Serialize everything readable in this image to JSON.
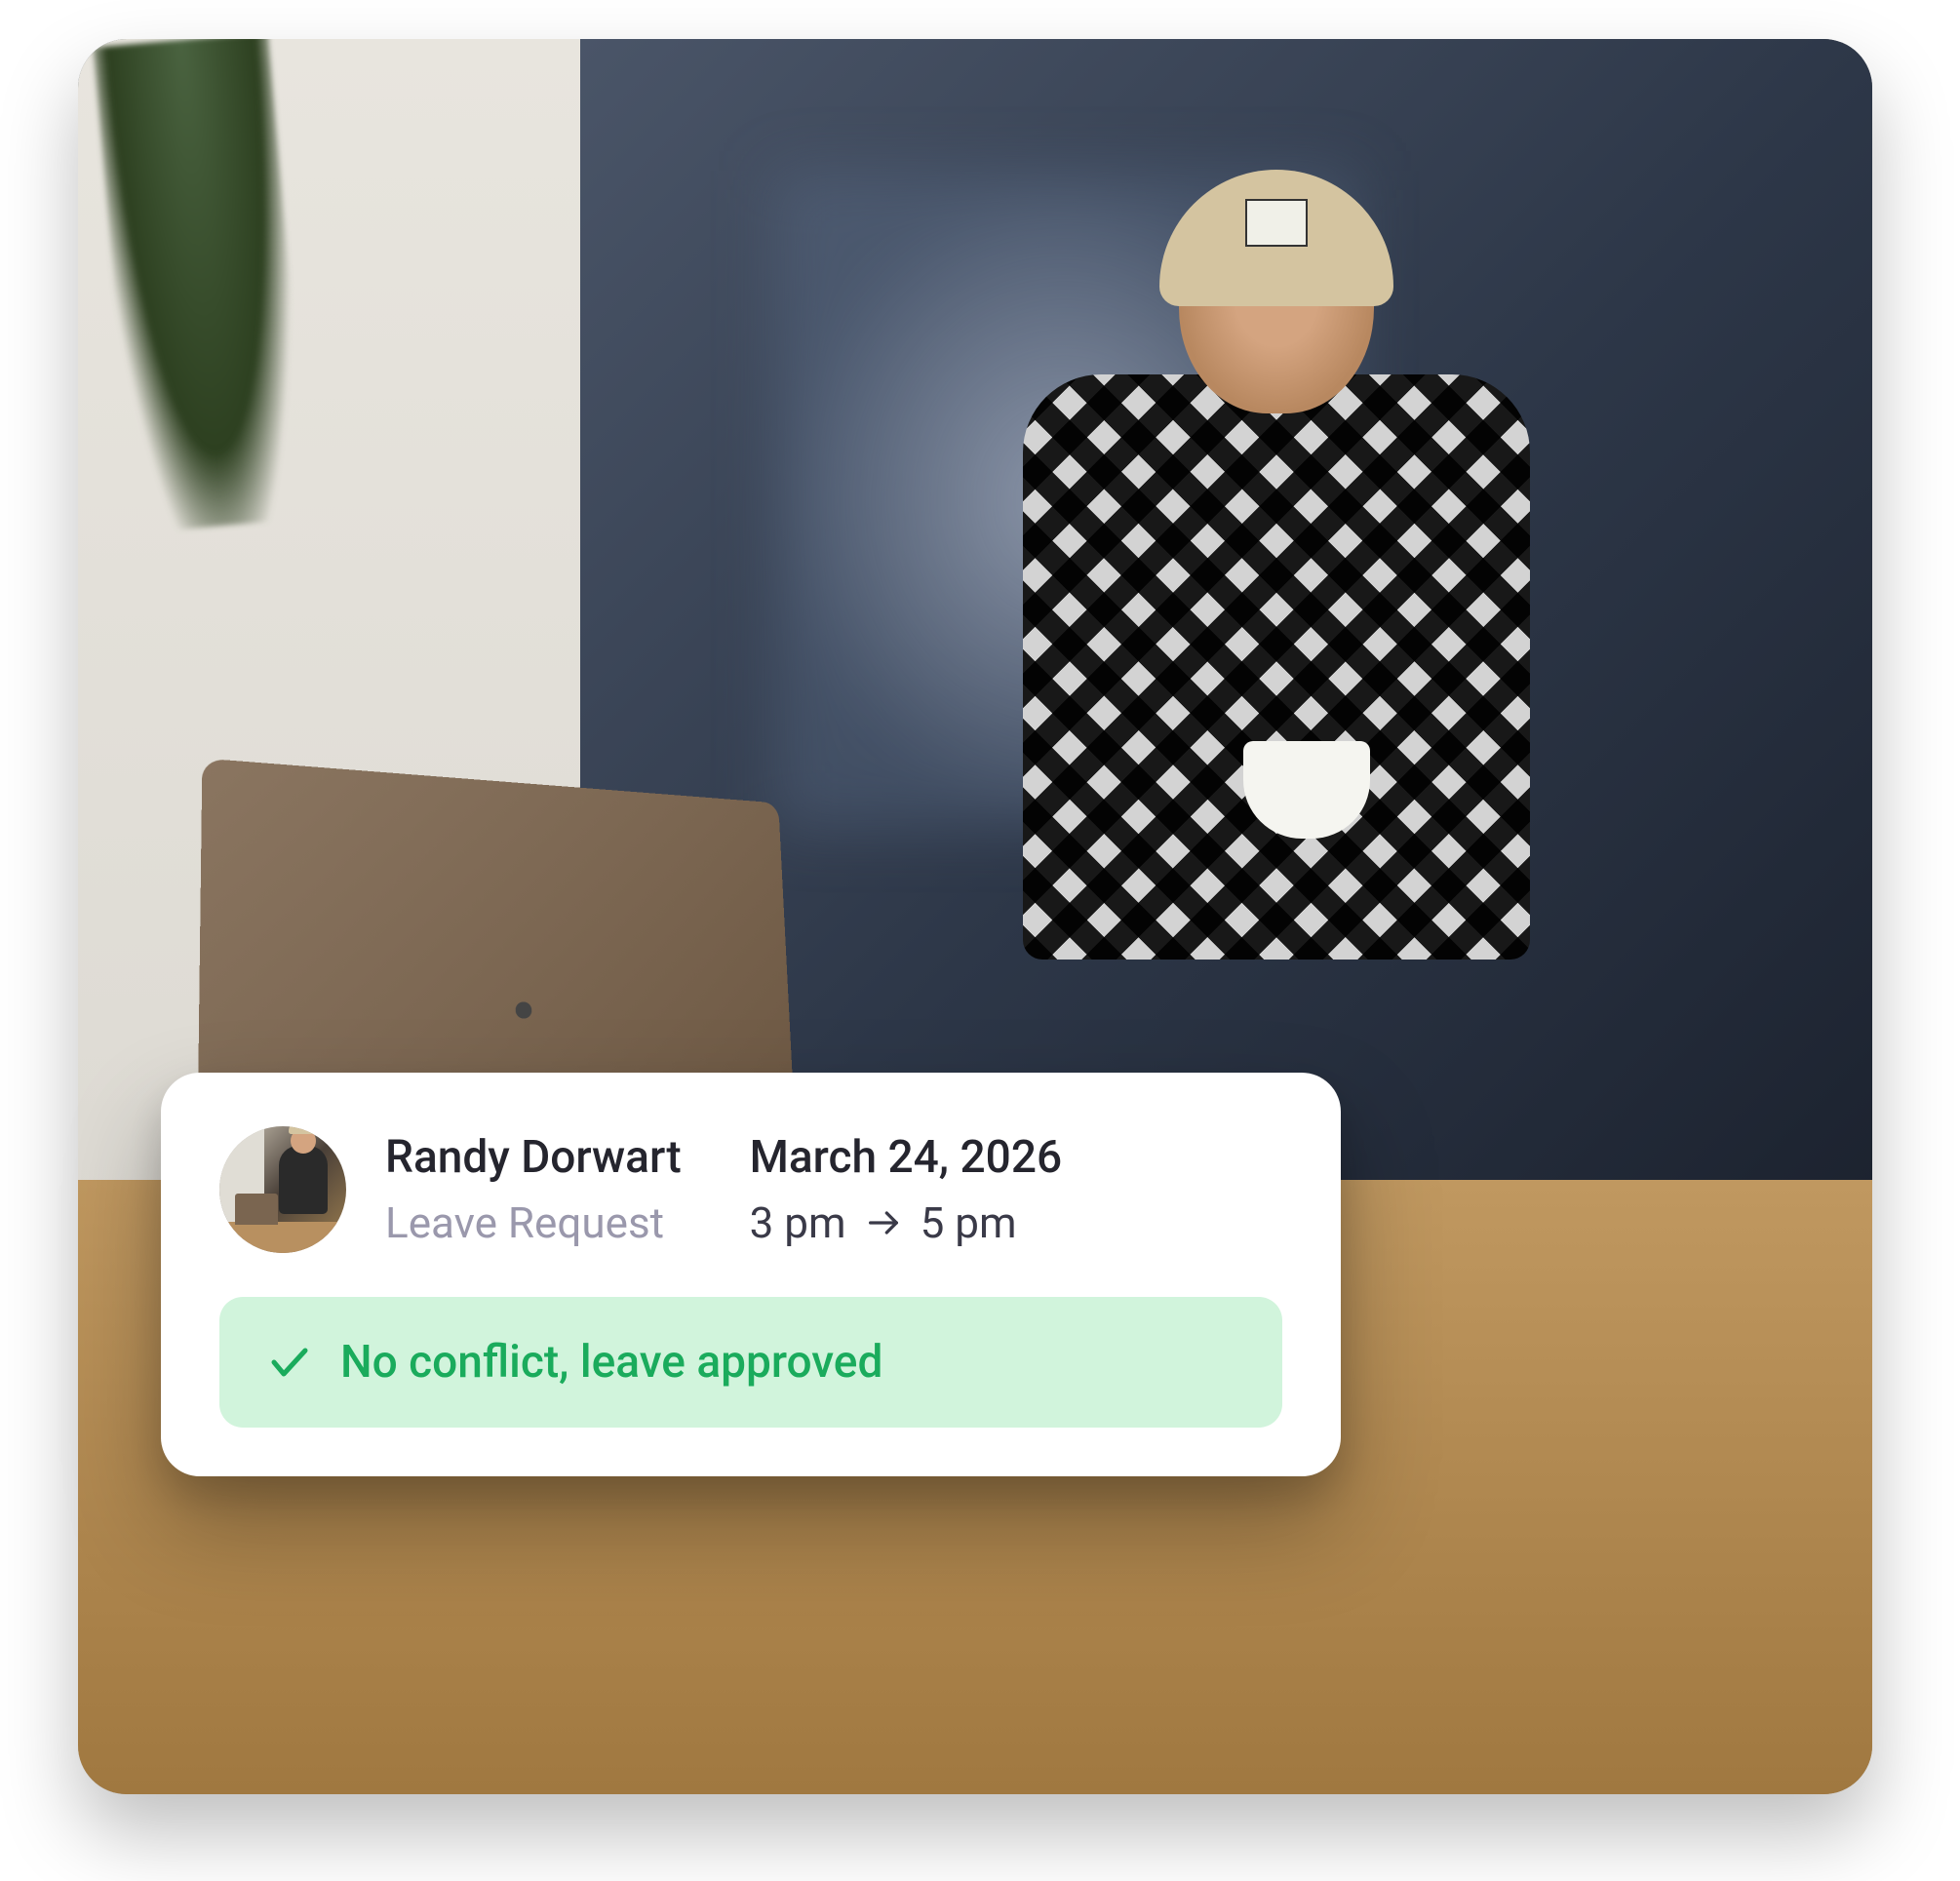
{
  "card": {
    "employee_name": "Randy Dorwart",
    "request_type": "Leave Request",
    "date": "March 24, 2026",
    "time_start": "3 pm",
    "time_end": "5 pm",
    "status_message": "No conflict, leave approved"
  },
  "colors": {
    "status_success_bg": "#d1f4dc",
    "status_success_text": "#1aab5c",
    "text_primary": "#25252e",
    "text_muted": "#9a98ac"
  }
}
